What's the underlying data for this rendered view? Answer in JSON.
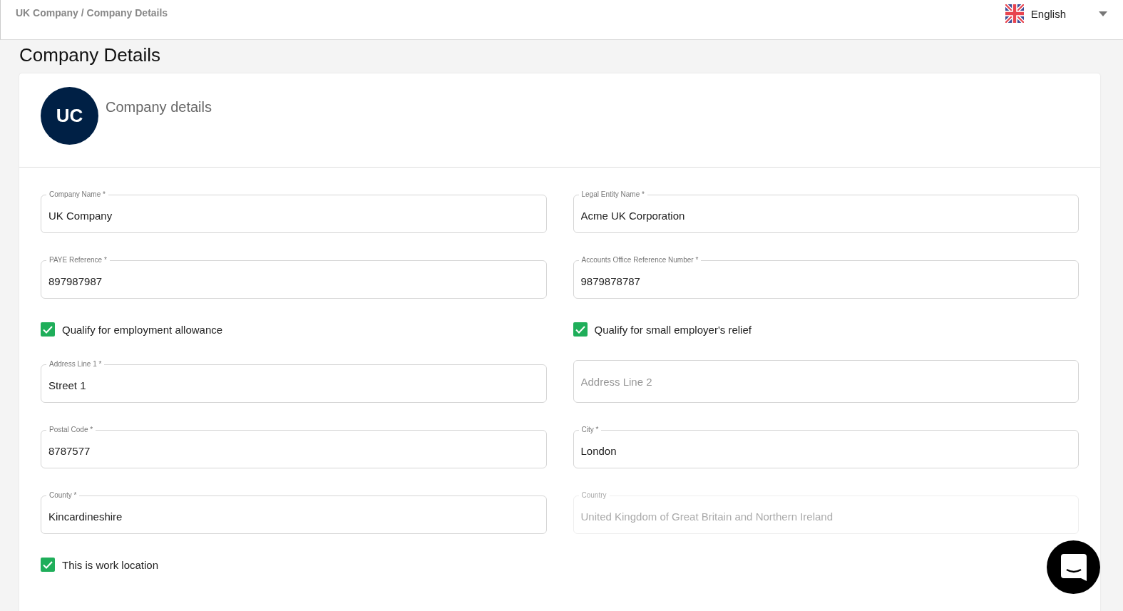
{
  "header": {
    "breadcrumb": "UK Company / Company Details",
    "language": "English"
  },
  "page_title": "Company Details",
  "card": {
    "avatar": "UC",
    "title": "Company details"
  },
  "fields": [
    {
      "kind": "field",
      "label": "Company Name *",
      "value": "UK Company",
      "disabled": false
    },
    {
      "kind": "field",
      "label": "Legal Entity Name *",
      "value": "Acme UK Corporation",
      "disabled": false
    },
    {
      "kind": "field",
      "label": "PAYE Reference *",
      "value": "897987987",
      "disabled": false
    },
    {
      "kind": "field",
      "label": "Accounts Office Reference Number *",
      "value": "9879878787",
      "disabled": false
    },
    {
      "kind": "checkbox",
      "label": "Qualify for employment allowance",
      "checked": true
    },
    {
      "kind": "checkbox",
      "label": "Qualify for small employer's relief",
      "checked": true
    },
    {
      "kind": "field",
      "label": "Address Line 1 *",
      "value": "Street 1",
      "disabled": false
    },
    {
      "kind": "field",
      "placeholder": "Address Line 2",
      "disabled": false
    },
    {
      "kind": "field",
      "label": "Postal Code *",
      "value": "8787577",
      "disabled": false
    },
    {
      "kind": "field",
      "label": "City *",
      "value": "London",
      "disabled": false
    },
    {
      "kind": "field",
      "label": "County *",
      "value": "Kincardineshire",
      "disabled": false
    },
    {
      "kind": "field",
      "label": "Country",
      "value": "United Kingdom of Great Britain and Northern Ireland",
      "disabled": true
    },
    {
      "kind": "checkbox",
      "label": "This is work location",
      "checked": true
    }
  ]
}
